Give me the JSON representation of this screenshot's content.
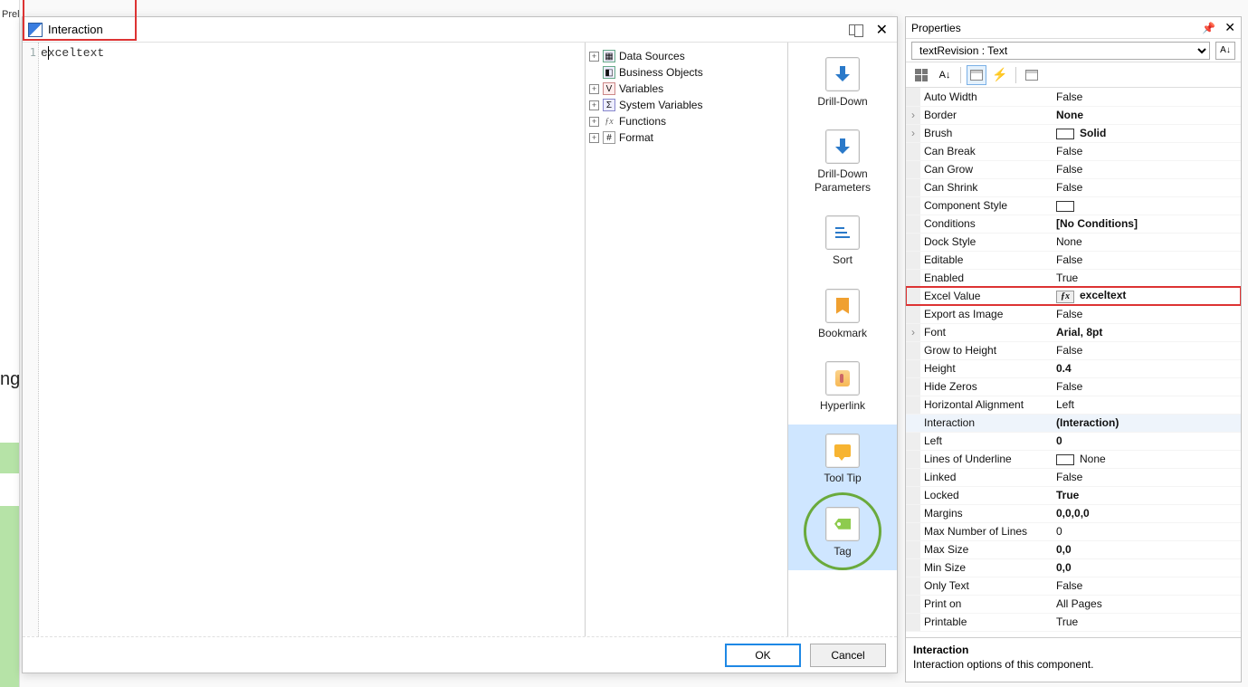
{
  "background": {
    "left_label": "Prel",
    "ng_text": "ng"
  },
  "dialog": {
    "title": "Interaction",
    "code_line_no": "1",
    "code_text": "exceltext",
    "tree": [
      {
        "label": "Data Sources",
        "icon": "db"
      },
      {
        "label": "Business Objects",
        "icon": "bo"
      },
      {
        "label": "Variables",
        "icon": "var"
      },
      {
        "label": "System Variables",
        "icon": "svar"
      },
      {
        "label": "Functions",
        "icon": "fx"
      },
      {
        "label": "Format",
        "icon": "fmt"
      }
    ],
    "side": [
      {
        "label": "Drill-Down"
      },
      {
        "label": "Drill-Down Parameters"
      },
      {
        "label": "Sort"
      },
      {
        "label": "Bookmark"
      },
      {
        "label": "Hyperlink"
      },
      {
        "label": "Tool Tip"
      },
      {
        "label": "Tag"
      }
    ],
    "ok": "OK",
    "cancel": "Cancel"
  },
  "props": {
    "title": "Properties",
    "selector": "textRevision : Text",
    "rows": [
      {
        "name": "Auto Width",
        "value": "False"
      },
      {
        "name": "Border",
        "value": "None",
        "bold": true,
        "expand": true
      },
      {
        "name": "Brush",
        "value": "Solid",
        "bold": true,
        "expand": true,
        "swatch": "#ffffff"
      },
      {
        "name": "Can Break",
        "value": "False"
      },
      {
        "name": "Can Grow",
        "value": "False"
      },
      {
        "name": "Can Shrink",
        "value": "False"
      },
      {
        "name": "Component Style",
        "value": "",
        "swatch": "#ffffff"
      },
      {
        "name": "Conditions",
        "value": "[No Conditions]",
        "bold": true
      },
      {
        "name": "Dock Style",
        "value": "None"
      },
      {
        "name": "Editable",
        "value": "False"
      },
      {
        "name": "Enabled",
        "value": "True"
      },
      {
        "name": "Excel Value",
        "value": "exceltext",
        "bold": true,
        "fx": true,
        "hl": true
      },
      {
        "name": "Export as Image",
        "value": "False"
      },
      {
        "name": "Font",
        "value": "Arial, 8pt",
        "bold": true,
        "expand": true
      },
      {
        "name": "Grow to Height",
        "value": "False"
      },
      {
        "name": "Height",
        "value": "0.4",
        "bold": true
      },
      {
        "name": "Hide Zeros",
        "value": "False"
      },
      {
        "name": "Horizontal Alignment",
        "value": "Left"
      },
      {
        "name": "Interaction",
        "value": "(Interaction)",
        "bold": true,
        "sel": true
      },
      {
        "name": "Left",
        "value": "0",
        "bold": true
      },
      {
        "name": "Lines of Underline",
        "value": "None",
        "swatch": "#ffffff"
      },
      {
        "name": "Linked",
        "value": "False"
      },
      {
        "name": "Locked",
        "value": "True",
        "bold": true
      },
      {
        "name": "Margins",
        "value": "0,0,0,0",
        "bold": true
      },
      {
        "name": "Max Number of Lines",
        "value": "0"
      },
      {
        "name": "Max Size",
        "value": "0,0",
        "bold": true
      },
      {
        "name": "Min Size",
        "value": "0,0",
        "bold": true
      },
      {
        "name": "Only Text",
        "value": "False"
      },
      {
        "name": "Print on",
        "value": "All Pages"
      },
      {
        "name": "Printable",
        "value": "True"
      }
    ],
    "desc_title": "Interaction",
    "desc_text": "Interaction options of this component."
  }
}
